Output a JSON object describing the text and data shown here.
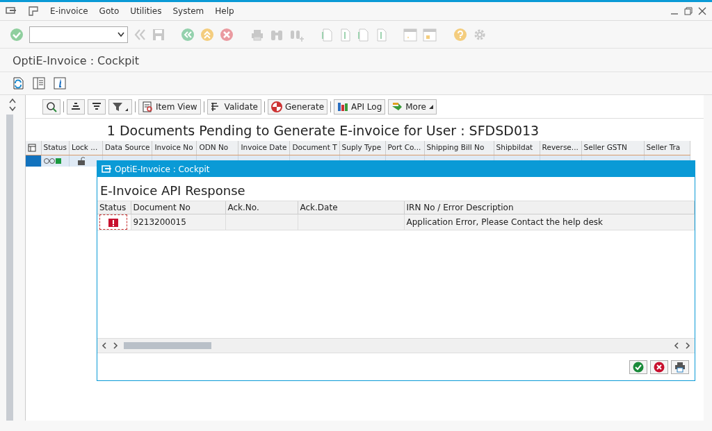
{
  "menu": [
    "E-invoice",
    "Goto",
    "Utilities",
    "System",
    "Help"
  ],
  "screen_title": "OptiE-Invoice : Cockpit",
  "alv_toolbar": [
    {
      "label": "Item View",
      "kind": "item"
    },
    {
      "label": "Validate",
      "kind": "validate"
    },
    {
      "label": "Generate",
      "kind": "generate"
    },
    {
      "label": "API Log",
      "kind": "log"
    },
    {
      "label": "More",
      "kind": "more"
    }
  ],
  "grid_title": "1 Documents Pending to Generate E-invoice for User : SFDSD013",
  "grid": {
    "columns": [
      "Status",
      "Lock ...",
      "Data Source",
      "Invoice No",
      "ODN No",
      "Invoice Date",
      "Document T",
      "Suply Type",
      "Port Co...",
      "Shipping Bill No",
      "Shipbildat",
      "Reverse...",
      "Seller GSTN",
      "Seller Tra"
    ],
    "rows": [
      {
        "selected": true
      }
    ]
  },
  "dialog": {
    "title": "OptiE-Invoice : Cockpit",
    "heading": "E-Invoice API Response",
    "columns": [
      "Status",
      "Document No",
      "Ack.No.",
      "Ack.Date",
      "IRN No / Error Description"
    ],
    "rows": [
      {
        "error": true,
        "cells": [
          "",
          "9213200015",
          "",
          "",
          "Application Error, Please Contact the help desk"
        ]
      }
    ]
  }
}
